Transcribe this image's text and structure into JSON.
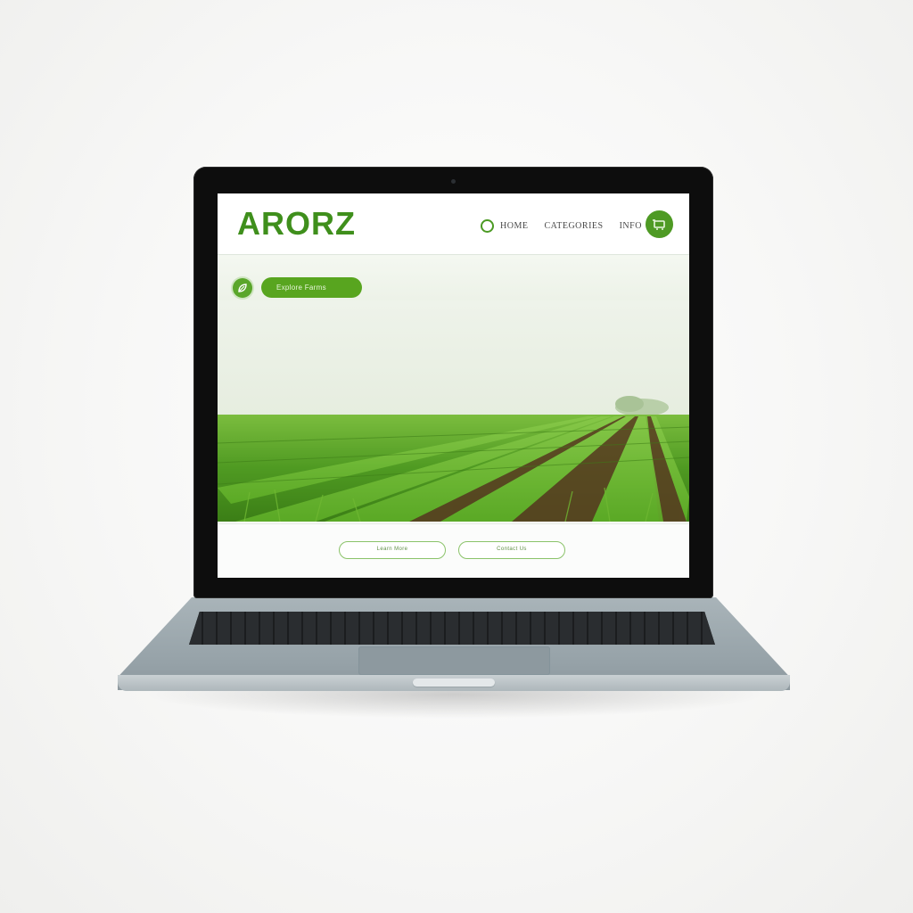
{
  "site": {
    "logo": "ARORZ",
    "nav": {
      "links": [
        "HOME",
        "CATEGORIES",
        "INFO"
      ]
    },
    "hero": {
      "cta_label": "Explore Farms"
    },
    "footer": {
      "buttons": [
        "Learn More",
        "Contact Us"
      ]
    }
  },
  "icons": {
    "nav_circle": "circle-icon",
    "cart": "cart-icon",
    "badge": "leaf-icon"
  },
  "colors": {
    "brand_green": "#3f8f1c",
    "accent_green": "#58a51f",
    "laptop_frame": "#0d0d0d",
    "laptop_base": "#96a2a8"
  }
}
